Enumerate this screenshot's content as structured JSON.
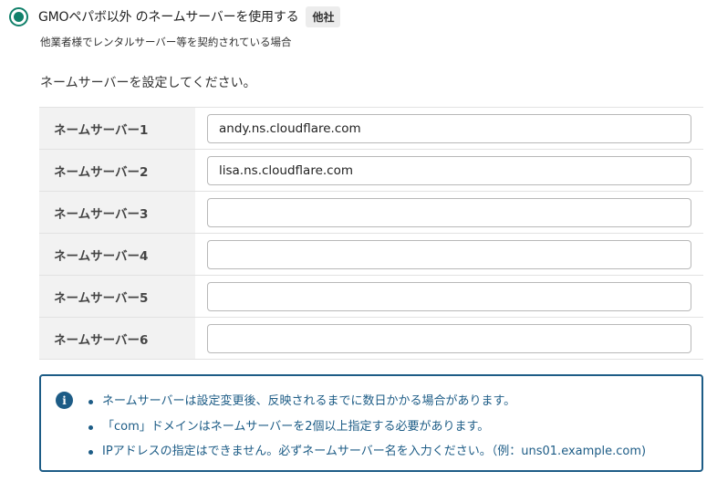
{
  "option": {
    "label": "GMOペパボ以外 のネームサーバーを使用する",
    "badge": "他社",
    "description": "他業者様でレンタルサーバー等を契約されている場合",
    "selected": true
  },
  "instruction": "ネームサーバーを設定してください。",
  "nameservers": [
    {
      "label": "ネームサーバー1",
      "value": "andy.ns.cloudflare.com"
    },
    {
      "label": "ネームサーバー2",
      "value": "lisa.ns.cloudflare.com"
    },
    {
      "label": "ネームサーバー3",
      "value": ""
    },
    {
      "label": "ネームサーバー4",
      "value": ""
    },
    {
      "label": "ネームサーバー5",
      "value": ""
    },
    {
      "label": "ネームサーバー6",
      "value": ""
    }
  ],
  "info": {
    "icon": "info-icon",
    "items": [
      "ネームサーバーは設定変更後、反映されるまでに数日かかる場合があります。",
      "「com」ドメインはネームサーバーを2個以上指定する必要があります。",
      "IPアドレスの指定はできません。必ずネームサーバー名を入力ください。（例：uns01.example.com)"
    ]
  },
  "colors": {
    "accent": "#11806a",
    "info": "#1d5c86",
    "label_bg": "#f2f2f2"
  }
}
